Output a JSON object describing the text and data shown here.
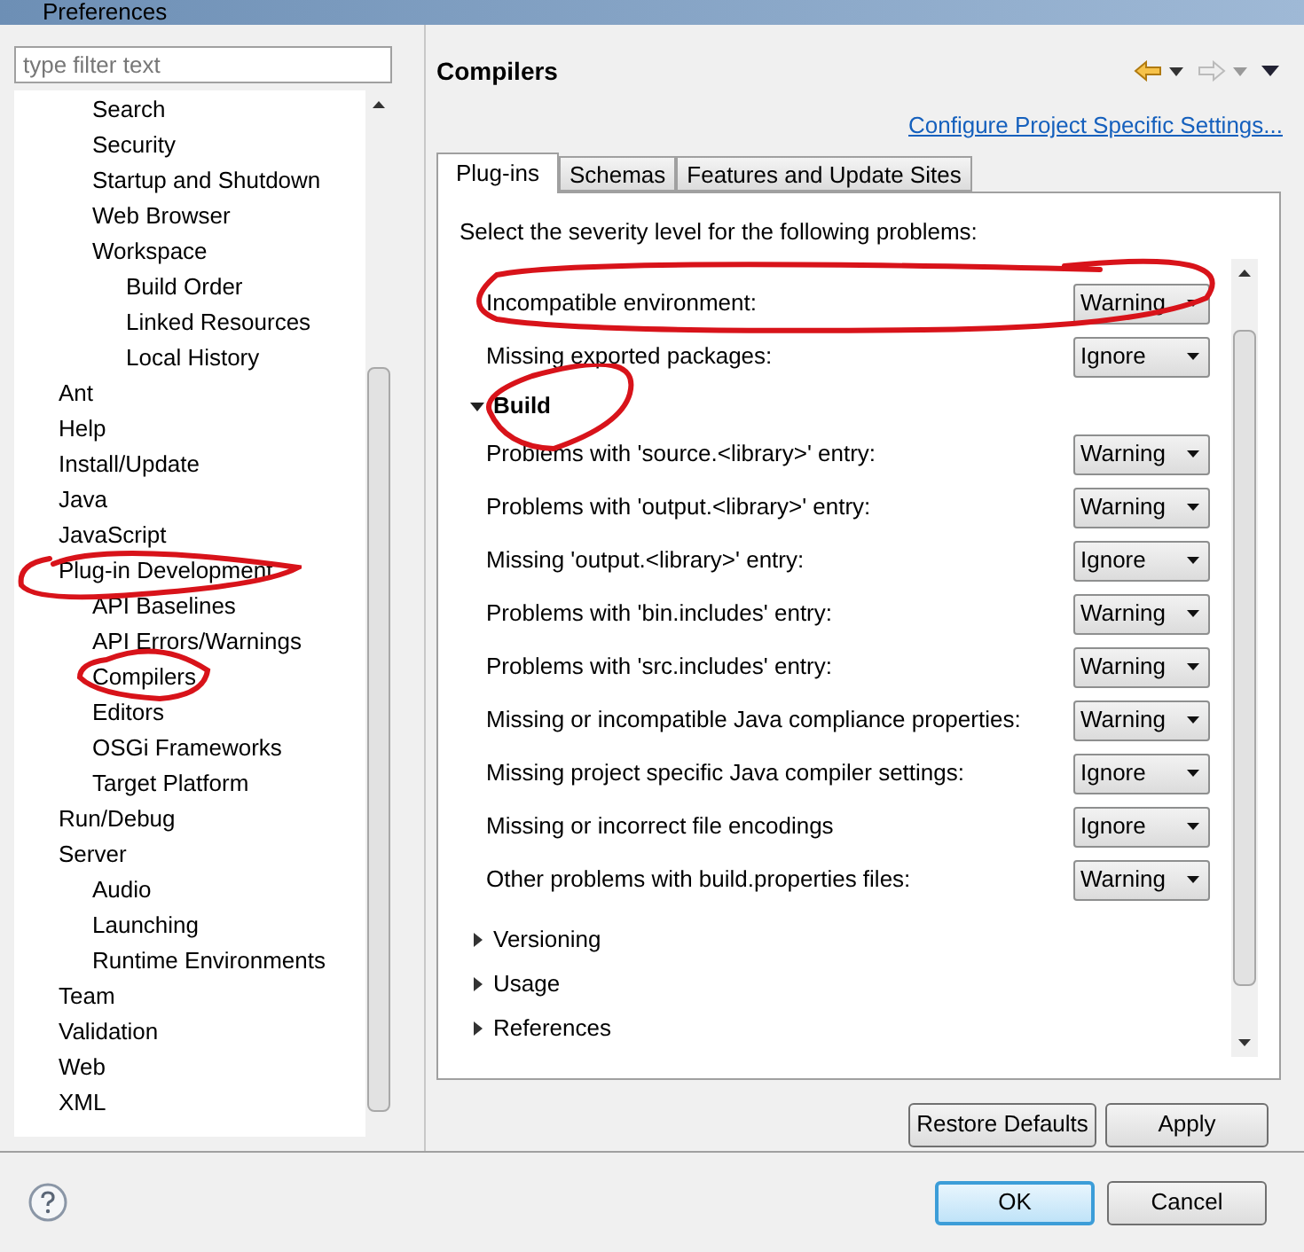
{
  "window": {
    "title": "Preferences"
  },
  "filter": {
    "placeholder": "type filter text"
  },
  "tree": [
    {
      "children": [
        {
          "label": "Search"
        },
        {
          "label": "Security"
        },
        {
          "label": "Startup and Shutdown"
        },
        {
          "label": "Web Browser"
        },
        {
          "label": "Workspace",
          "children": [
            {
              "label": "Build Order"
            },
            {
              "label": "Linked Resources"
            },
            {
              "label": "Local History"
            }
          ]
        }
      ]
    },
    {
      "label": "Ant"
    },
    {
      "label": "Help"
    },
    {
      "label": "Install/Update"
    },
    {
      "label": "Java"
    },
    {
      "label": "JavaScript"
    },
    {
      "label": "Plug-in Development",
      "children": [
        {
          "label": "API Baselines"
        },
        {
          "label": "API Errors/Warnings"
        },
        {
          "label": "Compilers"
        },
        {
          "label": "Editors"
        },
        {
          "label": "OSGi Frameworks"
        },
        {
          "label": "Target Platform"
        }
      ]
    },
    {
      "label": "Run/Debug"
    },
    {
      "label": "Server",
      "children": [
        {
          "label": "Audio"
        },
        {
          "label": "Launching"
        },
        {
          "label": "Runtime Environments"
        }
      ]
    },
    {
      "label": "Team"
    },
    {
      "label": "Validation"
    },
    {
      "label": "Web"
    },
    {
      "label": "XML"
    }
  ],
  "page": {
    "title": "Compilers",
    "link": "Configure Project Specific Settings...",
    "tabs": [
      {
        "label": "Plug-ins",
        "selected": true
      },
      {
        "label": "Schemas",
        "selected": false
      },
      {
        "label": "Features and Update Sites",
        "selected": false
      }
    ],
    "description": "Select the severity level for the following problems:",
    "sections": [
      {
        "rows": [
          {
            "label": "Incompatible environment:",
            "value": "Warning"
          },
          {
            "label": "Missing exported packages:",
            "value": "Ignore"
          }
        ]
      },
      {
        "label": "Build",
        "expanded": true,
        "rows": [
          {
            "label": "Problems with 'source.<library>' entry:",
            "value": "Warning"
          },
          {
            "label": "Problems with 'output.<library>' entry:",
            "value": "Warning"
          },
          {
            "label": "Missing 'output.<library>' entry:",
            "value": "Ignore"
          },
          {
            "label": "Problems with 'bin.includes' entry:",
            "value": "Warning"
          },
          {
            "label": "Problems with 'src.includes' entry:",
            "value": "Warning"
          },
          {
            "label": "Missing or incompatible Java compliance properties:",
            "value": "Warning"
          },
          {
            "label": "Missing project specific Java compiler settings:",
            "value": "Ignore"
          },
          {
            "label": "Missing or incorrect file encodings",
            "value": "Ignore"
          },
          {
            "label": "Other problems with build.properties files:",
            "value": "Warning"
          }
        ]
      },
      {
        "label": "Versioning",
        "expanded": false
      },
      {
        "label": "Usage",
        "expanded": false
      },
      {
        "label": "References",
        "expanded": false
      }
    ],
    "buttons": [
      "Restore Defaults",
      "Apply"
    ]
  },
  "dialog_buttons": [
    {
      "label": "OK",
      "default": true
    },
    {
      "label": "Cancel",
      "default": false
    }
  ]
}
